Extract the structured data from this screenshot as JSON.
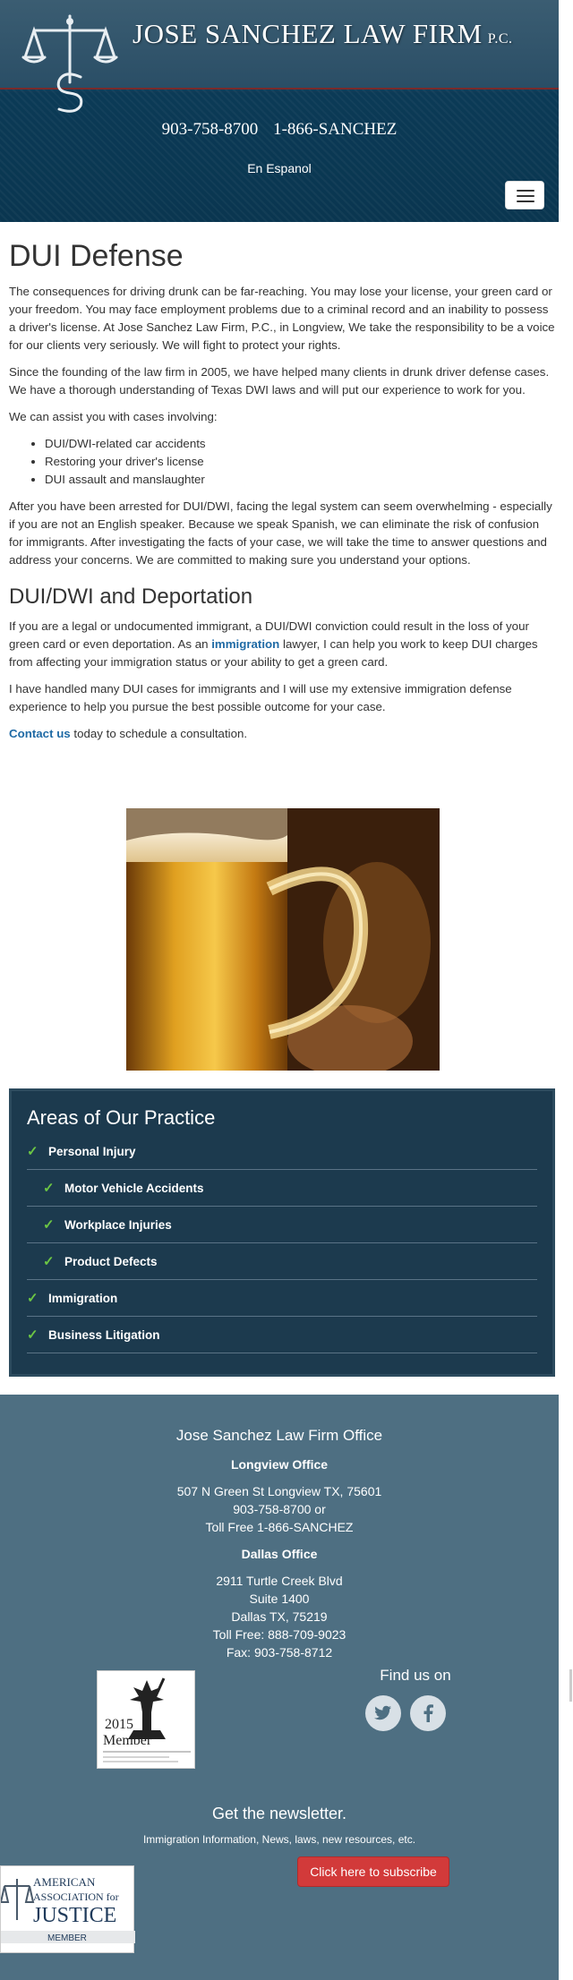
{
  "header": {
    "firm_name": "JOSE SANCHEZ LAW FIRM",
    "firm_suffix": "P.C.",
    "phone_1": "903-758-8700",
    "phone_2": "1-866-SANCHEZ",
    "language_link": "En Espanol",
    "menu_icon": "hamburger-icon"
  },
  "main": {
    "title": "DUI Defense",
    "p1": "The consequences for driving drunk can be far-reaching. You may lose your license, your green card or your freedom. You may face employment problems due to a criminal record and an inability to possess a driver's license. At Jose Sanchez Law Firm, P.C., in Longview, We take the responsibility to be a voice for our clients very seriously. We will fight to protect your rights.",
    "p2": "Since the founding of the law firm in 2005, we have helped many clients in drunk driver defense cases. We have a thorough understanding of Texas DWI laws and will put our experience to work for you.",
    "p3": "We can assist you with cases involving:",
    "list": [
      "DUI/DWI-related car accidents",
      "Restoring your driver's license",
      "DUI assault and manslaughter"
    ],
    "p4": "After you have been arrested for DUI/DWI, facing the legal system can seem overwhelming - especially if you are not an English speaker. Because we speak Spanish, we can eliminate the risk of confusion for immigrants. After investigating the facts of your case, we will take the time to answer questions and address your concerns. We are committed to making sure you understand your options.",
    "subtitle": "DUI/DWI and Deportation",
    "p5_before": "If you are a legal or undocumented immigrant, a DUI/DWI conviction could result in the loss of your green card or even deportation. As an ",
    "p5_link": "immigration",
    "p5_after": " lawyer, I can help you work to keep DUI charges from affecting your immigration status or your ability to get a green card.",
    "p6": "I have handled many DUI cases for immigrants and I will use my extensive immigration defense experience to help you pursue the best possible outcome for your case.",
    "p7_link": "Contact us",
    "p7_after": " today to schedule a consultation."
  },
  "practice": {
    "title": "Areas of Our Practice",
    "items": [
      {
        "label": "Personal Injury",
        "sub": false
      },
      {
        "label": "Motor Vehicle Accidents",
        "sub": true
      },
      {
        "label": "Workplace Injuries",
        "sub": true
      },
      {
        "label": "Product Defects",
        "sub": true
      },
      {
        "label": "Immigration",
        "sub": false
      },
      {
        "label": "Business Litigation",
        "sub": false
      }
    ]
  },
  "footer": {
    "office_title": "Jose Sanchez Law Firm Office",
    "longview_heading": "Longview Office",
    "longview_address": "507 N Green St Longview TX, 75601",
    "longview_phone": "903-758-8700 or",
    "longview_tollfree": "Toll Free 1-866-SANCHEZ",
    "dallas_heading": "Dallas Office",
    "dallas_line1": "2911 Turtle Creek Blvd",
    "dallas_line2": "Suite 1400",
    "dallas_line3": "Dallas TX, 75219",
    "dallas_tollfree": "Toll Free: 888-709-9023",
    "dallas_fax": "Fax: 903-758-8712",
    "member_year": "2015",
    "member_text": "Member",
    "find_us": "Find us on",
    "newsletter_title": "Get the newsletter.",
    "newsletter_sub": "Immigration Information, News, laws, new resources, etc.",
    "subscribe_label": "Click here to subscribe",
    "aaj_line1": "AMERICAN",
    "aaj_line2": "ASSOCIATION for",
    "aaj_line3": "JUSTICE",
    "aaj_line4": "MEMBER"
  },
  "colors": {
    "header_bg": "#0e3a55",
    "practice_bg": "#1c3a4e",
    "footer_bg": "#4e6f82",
    "link": "#1f6aa5",
    "check": "#6cc644",
    "subscribe": "#d23a3a"
  }
}
